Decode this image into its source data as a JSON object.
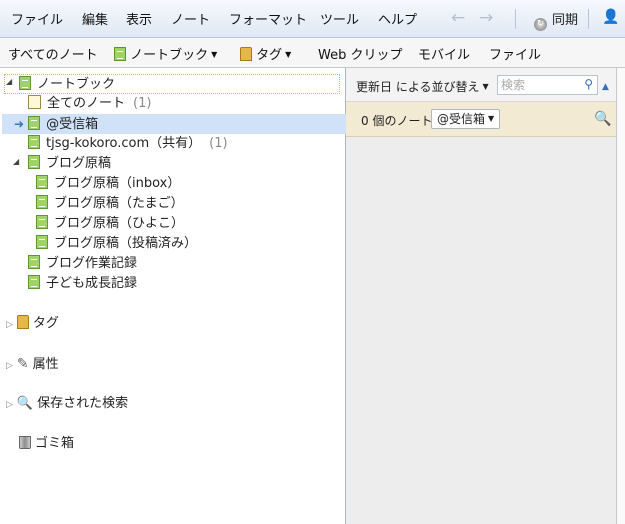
{
  "menubar": {
    "items": [
      "ファイル",
      "編集",
      "表示",
      "ノート",
      "フォーマット",
      "ツール",
      "ヘルプ"
    ],
    "back_icon": "back-arrow-icon",
    "forward_icon": "forward-arrow-icon",
    "sync_label": "同期",
    "user_icon": "user-icon"
  },
  "toolbar": {
    "all_notes": "すべてのノート",
    "notebooks": "ノートブック",
    "tags": "タグ",
    "web_clip": "Web クリップ",
    "mobile": "モバイル",
    "file": "ファイル"
  },
  "tree": {
    "root_label": "ノートブック",
    "all_notes_label": "全てのノート",
    "all_notes_count": "(1)",
    "inbox_label": "@受信箱",
    "shared_label": "tjsg-kokoro.com（共有）",
    "shared_count": "(1)",
    "stack_label": "ブログ原稿",
    "stack_children": [
      "ブログ原稿（inbox）",
      "ブログ原稿（たまご）",
      "ブログ原稿（ひよこ）",
      "ブログ原稿（投稿済み）"
    ],
    "blog_work_label": "ブログ作業記録",
    "child_growth_label": "子ども成長記録"
  },
  "sections": {
    "tags": "タグ",
    "attributes": "属性",
    "saved_searches": "保存された検索",
    "trash": "ゴミ箱"
  },
  "note_list": {
    "sort_label": "更新日 による並び替え",
    "search_placeholder": "検索",
    "count_label": "0 個のノート",
    "notebook_filter": "@受信箱"
  },
  "colors": {
    "menubar_bg": "#dfe8f4",
    "selected_row": "#cfe2f7",
    "info_bar": "#f3ead3",
    "notebook_green": "#9fd26b"
  }
}
